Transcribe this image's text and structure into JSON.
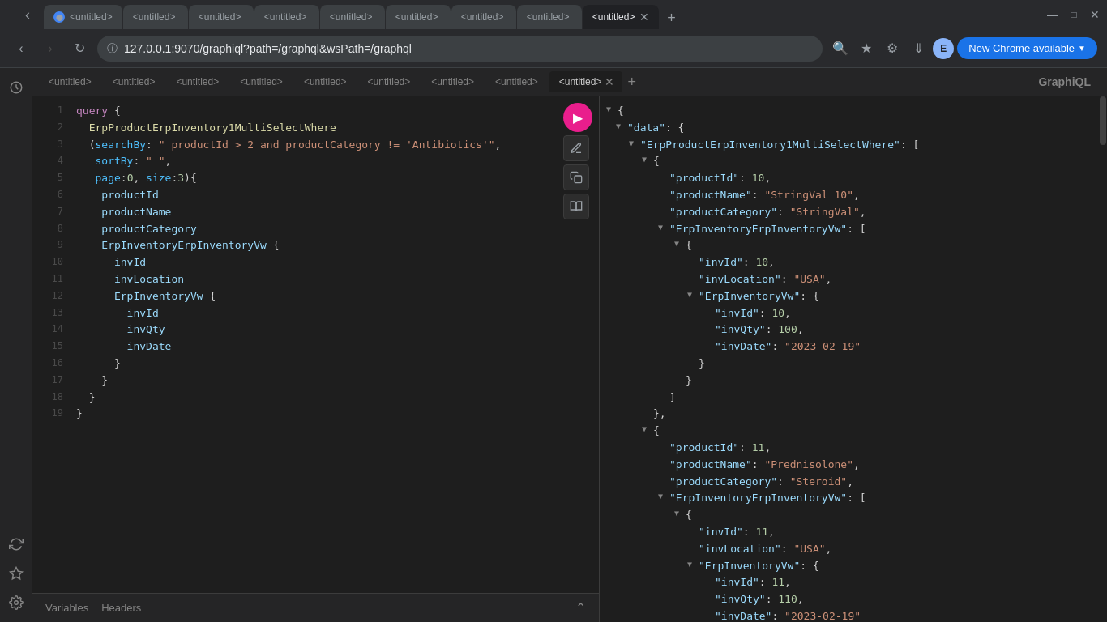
{
  "browser": {
    "title": "127.0.0.1:9070/graphiql?path=/",
    "url": "127.0.0.1:9070/graphiql?path=/graphql&wsPath=/graphql",
    "new_chrome_label": "New Chrome available",
    "tabs": [
      {
        "label": "<untitled>",
        "active": false
      },
      {
        "label": "<untitled>",
        "active": false
      },
      {
        "label": "<untitled>",
        "active": false
      },
      {
        "label": "<untitled>",
        "active": false
      },
      {
        "label": "<untitled>",
        "active": false
      },
      {
        "label": "<untitled>",
        "active": false
      },
      {
        "label": "<untitled>",
        "active": false
      },
      {
        "label": "<untitled>",
        "active": false
      },
      {
        "label": "<untitled>",
        "active": true
      }
    ]
  },
  "graphiql": {
    "label": "GraphiQL",
    "variables_label": "Variables",
    "headers_label": "Headers",
    "editor_lines": [
      {
        "num": "1",
        "content": "query {"
      },
      {
        "num": "2",
        "content": "  ErpProductErpInventory1MultiSelectWhere"
      },
      {
        "num": "3",
        "content": "  (searchBy: \" productId > 2 and productCategory != 'Antibiotics'\","
      },
      {
        "num": "4",
        "content": "   sortBy: \" \","
      },
      {
        "num": "5",
        "content": "   page:0, size:3){"
      },
      {
        "num": "6",
        "content": "    productId"
      },
      {
        "num": "7",
        "content": "    productName"
      },
      {
        "num": "8",
        "content": "    productCategory"
      },
      {
        "num": "9",
        "content": "    ErpInventoryErpInventoryVw {"
      },
      {
        "num": "10",
        "content": "      invId"
      },
      {
        "num": "11",
        "content": "      invLocation"
      },
      {
        "num": "12",
        "content": "      ErpInventoryVw {"
      },
      {
        "num": "13",
        "content": "        invId"
      },
      {
        "num": "14",
        "content": "        invQty"
      },
      {
        "num": "15",
        "content": "        invDate"
      },
      {
        "num": "16",
        "content": "      }"
      },
      {
        "num": "17",
        "content": "    }"
      },
      {
        "num": "18",
        "content": "  }"
      },
      {
        "num": "19",
        "content": "}"
      }
    ],
    "result": {
      "raw": "{\"data\":{\"ErpProductErpInventory1MultiSelectWhere\":[{\"productId\":10,\"productName\":\"StringVal 10\",\"productCategory\":\"StringVal\",\"ErpInventoryErpInventoryVw\":[{\"invId\":10,\"invLocation\":\"USA\",\"ErpInventoryVw\":{\"invId\":10,\"invQty\":100,\"invDate\":\"2023-02-19\"}}]},{\"productId\":11,\"productName\":\"Prednisolone\",\"productCategory\":\"Steroid\",\"ErpInventoryErpInventoryVw\":[{\"invId\":11,\"invLocation\":\"USA\",\"ErpInventoryVw\":{\"invId\":11,\"invQty\":110,\"invDate\":\"2023-02-19\"}}]}]}"
    }
  }
}
